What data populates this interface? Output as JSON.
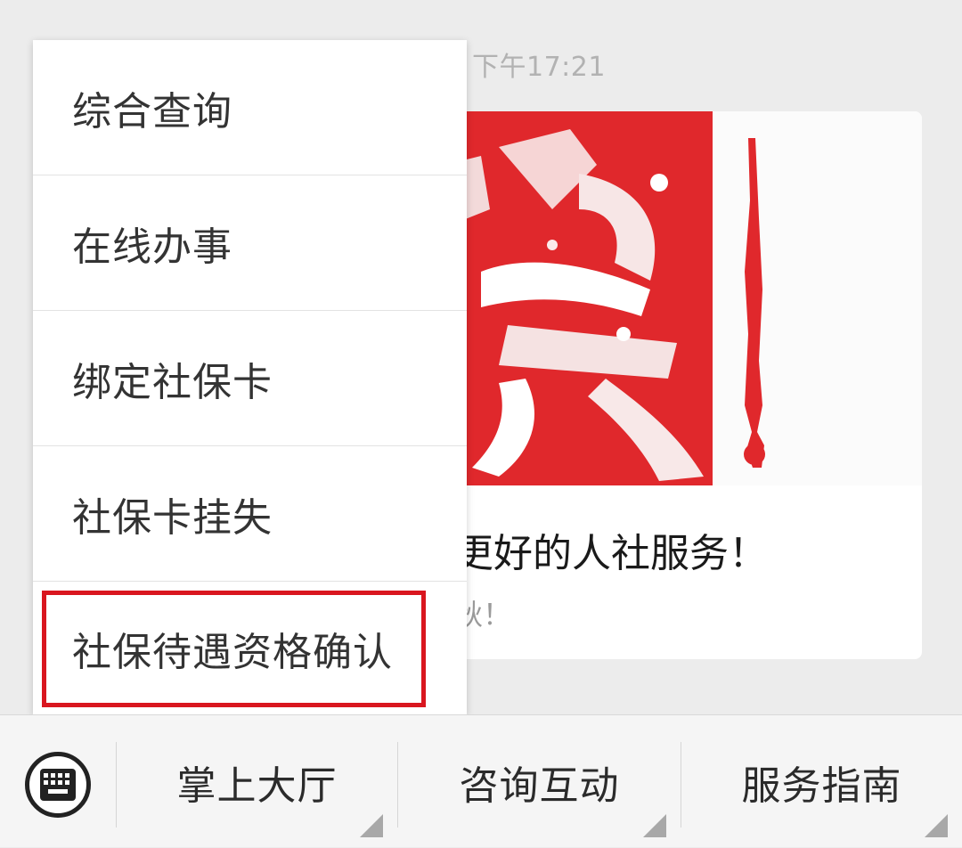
{
  "chat": {
    "timestamp": "下午17:21",
    "article": {
      "title": "更好的人社服务！",
      "desc": "秋！"
    }
  },
  "popup_menu": {
    "items": [
      {
        "label": "综合查询"
      },
      {
        "label": "在线办事"
      },
      {
        "label": "绑定社保卡"
      },
      {
        "label": "社保卡挂失"
      },
      {
        "label": "社保待遇资格确认"
      }
    ],
    "highlighted_index": 4,
    "highlight_color": "#d9161f"
  },
  "bottom_bar": {
    "keyboard_icon": "keyboard-icon",
    "tabs": [
      {
        "label": "掌上大厅"
      },
      {
        "label": "咨询互动"
      },
      {
        "label": "服务指南"
      }
    ]
  },
  "colors": {
    "seal_red": "#e0282c",
    "background": "#ececec"
  }
}
